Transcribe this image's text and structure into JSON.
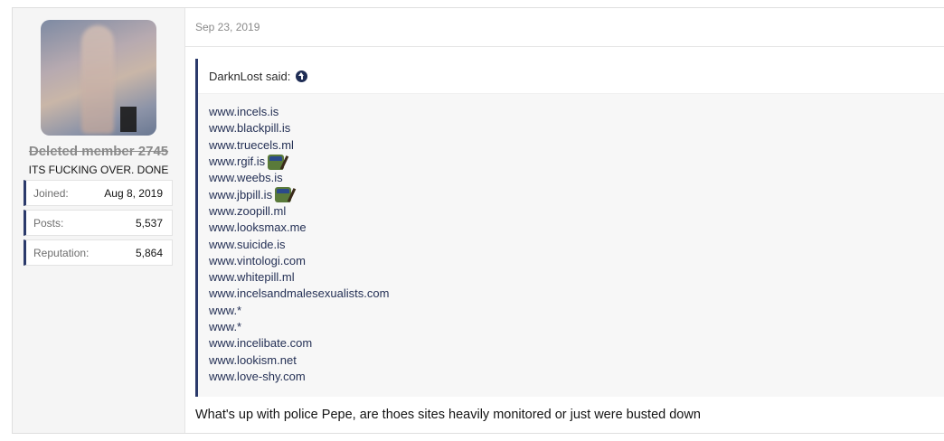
{
  "user": {
    "name": "Deleted member 2745",
    "title": "ITS FUCKING OVER. DONE",
    "stats": [
      {
        "label": "Joined:",
        "value": "Aug 8, 2019"
      },
      {
        "label": "Posts:",
        "value": "5,537"
      },
      {
        "label": "Reputation:",
        "value": "5,864"
      }
    ]
  },
  "post": {
    "date": "Sep 23, 2019",
    "quote": {
      "author_label": "DarknLost said:",
      "icon": "arrow-up-circle-icon",
      "lines": [
        {
          "text": "www.incels.is",
          "emoji": false
        },
        {
          "text": "www.blackpill.is",
          "emoji": false
        },
        {
          "text": "www.truecels.ml",
          "emoji": false
        },
        {
          "text": "www.rgif.is",
          "emoji": true
        },
        {
          "text": "www.weebs.is",
          "emoji": false
        },
        {
          "text": "www.jbpill.is",
          "emoji": true
        },
        {
          "text": "www.zoopill.ml",
          "emoji": false
        },
        {
          "text": "www.looksmax.me",
          "emoji": false
        },
        {
          "text": "www.suicide.is",
          "emoji": false
        },
        {
          "text": "www.vintologi.com",
          "emoji": false
        },
        {
          "text": "www.whitepill.ml",
          "emoji": false
        },
        {
          "text": "www.incelsandmalesexualists.com",
          "emoji": false
        },
        {
          "text": "www.*",
          "emoji": false
        },
        {
          "text": "www.*",
          "emoji": false
        },
        {
          "text": "www.incelibate.com",
          "emoji": false
        },
        {
          "text": "www.lookism.net",
          "emoji": false
        },
        {
          "text": "www.love-shy.com",
          "emoji": false
        }
      ]
    },
    "reply": "What's up with police Pepe, are thoes sites heavily monitored or just were busted down"
  },
  "colors": {
    "accent": "#2b3a6b",
    "link": "#243055"
  }
}
